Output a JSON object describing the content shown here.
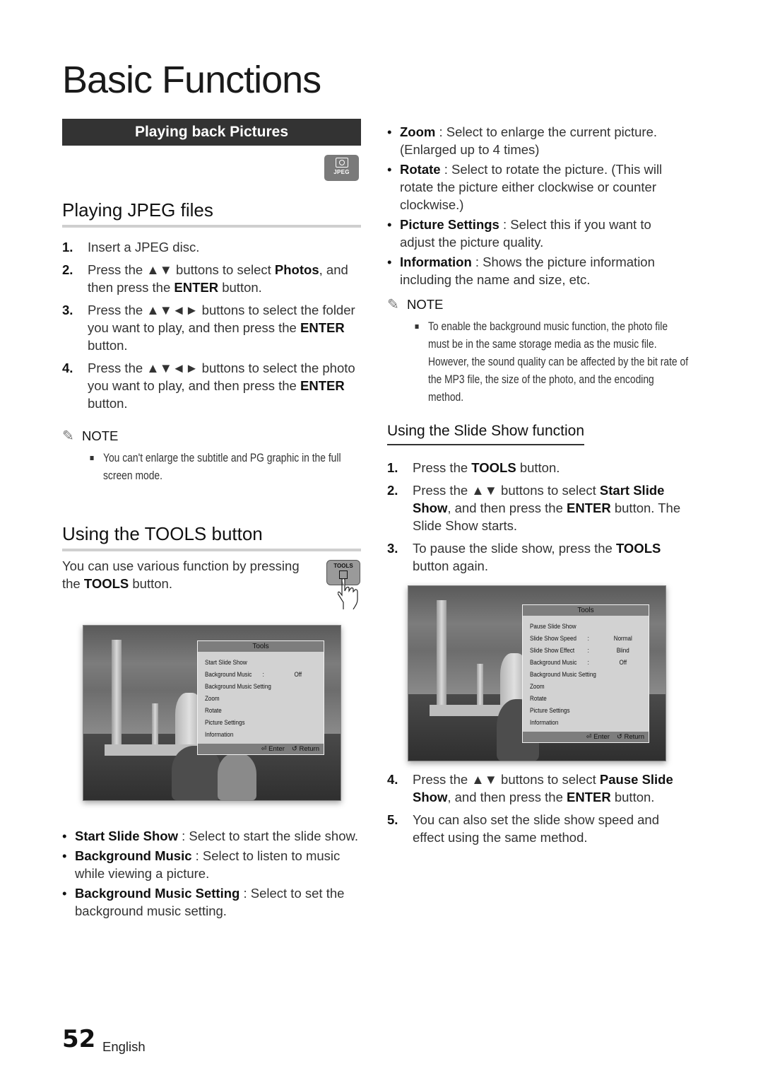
{
  "page": {
    "title": "Basic Functions",
    "section_bar": "Playing back Pictures",
    "jpeg_icon_label": "JPEG",
    "page_number": "52",
    "language": "English"
  },
  "playing_jpeg": {
    "heading": "Playing JPEG files",
    "steps": [
      {
        "num": "1.",
        "parts": [
          {
            "t": "Insert a JPEG disc."
          }
        ]
      },
      {
        "num": "2.",
        "parts": [
          {
            "t": "Press the ▲▼ buttons to select "
          },
          {
            "t": "Photos",
            "b": true
          },
          {
            "t": ", and then press the "
          },
          {
            "t": "ENTER",
            "b": true
          },
          {
            "t": " button."
          }
        ]
      },
      {
        "num": "3.",
        "parts": [
          {
            "t": "Press the ▲▼◄► buttons to select the folder you want to play, and then press the "
          },
          {
            "t": "ENTER",
            "b": true
          },
          {
            "t": " button."
          }
        ]
      },
      {
        "num": "4.",
        "parts": [
          {
            "t": "Press the ▲▼◄► buttons to select the photo you want to play, and then press the "
          },
          {
            "t": "ENTER",
            "b": true
          },
          {
            "t": " button."
          }
        ]
      }
    ],
    "note_label": "NOTE",
    "note_text": "You can't enlarge the subtitle and PG graphic in the full screen mode."
  },
  "tools_button": {
    "heading": "Using the TOOLS button",
    "intro_parts": [
      {
        "t": "You can use various function by pressing the "
      },
      {
        "t": "TOOLS",
        "b": true
      },
      {
        "t": " button."
      }
    ],
    "key_label": "TOOLS",
    "menu1": {
      "title": "Tools",
      "items": [
        {
          "label": "Start Slide Show"
        },
        {
          "label": "Background Music",
          "colon": ":",
          "value": "Off"
        },
        {
          "label": "Background Music Setting"
        },
        {
          "label": "Zoom"
        },
        {
          "label": "Rotate"
        },
        {
          "label": "Picture Settings"
        },
        {
          "label": "Information"
        }
      ],
      "footer_enter": "Enter",
      "footer_return": "Return"
    },
    "bullets_left": [
      {
        "term": "Start Slide Show",
        "desc": " : Select to start the slide show."
      },
      {
        "term": "Background Music",
        "desc": " : Select to listen to music while viewing a picture."
      },
      {
        "term": "Background Music Setting",
        "desc": " : Select to set the background music setting."
      }
    ],
    "bullets_right": [
      {
        "term": "Zoom",
        "desc": " : Select to enlarge the current picture. (Enlarged up to 4 times)"
      },
      {
        "term": "Rotate",
        "desc": " : Select to rotate the picture. (This will rotate the picture either clockwise or counter clockwise.)"
      },
      {
        "term": "Picture Settings",
        "desc": " : Select this if you want to adjust the picture quality."
      },
      {
        "term": "Information",
        "desc": " : Shows the picture information including the name and size, etc."
      }
    ],
    "note_label": "NOTE",
    "note_text": "To enable the background music function, the photo file must be in the same storage media as the music file. However, the sound quality can be affected by the bit rate of the MP3 file, the size of the photo, and the encoding method."
  },
  "slideshow": {
    "heading": "Using the Slide Show function",
    "steps_a": [
      {
        "num": "1.",
        "parts": [
          {
            "t": "Press the "
          },
          {
            "t": "TOOLS",
            "b": true
          },
          {
            "t": " button."
          }
        ]
      },
      {
        "num": "2.",
        "parts": [
          {
            "t": "Press the ▲▼ buttons to select "
          },
          {
            "t": "Start Slide Show",
            "b": true
          },
          {
            "t": ", and then press the "
          },
          {
            "t": "ENTER",
            "b": true
          },
          {
            "t": " button. The Slide Show starts."
          }
        ]
      },
      {
        "num": "3.",
        "parts": [
          {
            "t": "To pause the slide show, press the "
          },
          {
            "t": "TOOLS",
            "b": true
          },
          {
            "t": " button again."
          }
        ]
      }
    ],
    "menu2": {
      "title": "Tools",
      "items": [
        {
          "label": "Pause Slide Show"
        },
        {
          "label": "Slide Show Speed",
          "colon": ":",
          "value": "Normal"
        },
        {
          "label": "Slide Show Effect",
          "colon": ":",
          "value": "Blind"
        },
        {
          "label": "Background Music",
          "colon": ":",
          "value": "Off"
        },
        {
          "label": "Background Music Setting"
        },
        {
          "label": "Zoom"
        },
        {
          "label": "Rotate"
        },
        {
          "label": "Picture Settings"
        },
        {
          "label": "Information"
        }
      ],
      "footer_enter": "Enter",
      "footer_return": "Return"
    },
    "steps_b": [
      {
        "num": "4.",
        "parts": [
          {
            "t": "Press the ▲▼ buttons to select "
          },
          {
            "t": "Pause Slide Show",
            "b": true
          },
          {
            "t": ", and then press the "
          },
          {
            "t": "ENTER",
            "b": true
          },
          {
            "t": " button."
          }
        ]
      },
      {
        "num": "5.",
        "parts": [
          {
            "t": "You can also set the slide show speed and effect using the same method."
          }
        ]
      }
    ]
  }
}
